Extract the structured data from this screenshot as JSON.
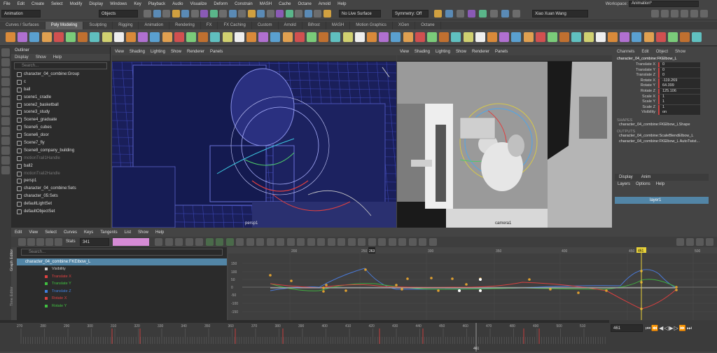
{
  "menubar": {
    "items": [
      "File",
      "Edit",
      "Create",
      "Select",
      "Modify",
      "Display",
      "Windows",
      "Key",
      "Playback",
      "Audio",
      "Visualize",
      "Deform",
      "Constrain",
      "MASH",
      "Cache",
      "Octane",
      "Arnold",
      "Help"
    ],
    "workspace_label": "Workspace:",
    "workspace_value": "Animation*"
  },
  "statusline": {
    "mode": "Animation",
    "select_mode": "Objects",
    "live_surface": "No Live Surface",
    "symmetry": "Symmetry: Off",
    "user": "Xiao Xuan Wang"
  },
  "shelf_tabs": [
    "Curves / Surfaces",
    "Poly Modeling",
    "Sculpting",
    "Rigging",
    "Animation",
    "Rendering",
    "FX",
    "FX Caching",
    "Custom",
    "Arnold",
    "Bifrost",
    "MASH",
    "Motion Graphics",
    "XGen",
    "Octane"
  ],
  "active_shelf": "Poly Modeling",
  "outliner": {
    "title": "Outliner",
    "menu": [
      "Display",
      "Show",
      "Help"
    ],
    "search_placeholder": "Search...",
    "items": [
      {
        "label": "character_04_combine:Group",
        "dim": false
      },
      {
        "label": "c",
        "dim": false
      },
      {
        "label": "ball",
        "dim": false
      },
      {
        "label": "scene1_cradle",
        "dim": false
      },
      {
        "label": "scene2_basketball",
        "dim": false
      },
      {
        "label": "scene3_study",
        "dim": false
      },
      {
        "label": "Scene4_graduate",
        "dim": false
      },
      {
        "label": "Scene5_cubes",
        "dim": false
      },
      {
        "label": "Scene6_door",
        "dim": false
      },
      {
        "label": "Scene7_fly",
        "dim": false
      },
      {
        "label": "Scene8_company_building",
        "dim": false
      },
      {
        "label": "motionTrail1Handle",
        "dim": true
      },
      {
        "label": "ball2",
        "dim": false
      },
      {
        "label": "motionTrail2Handle",
        "dim": true
      },
      {
        "label": "persp1",
        "dim": false
      },
      {
        "label": "character_04_combine:Sets",
        "dim": false
      },
      {
        "label": "character_05:Sets",
        "dim": false
      },
      {
        "label": "defaultLightSet",
        "dim": false
      },
      {
        "label": "defaultObjectSet",
        "dim": false
      }
    ]
  },
  "viewport_menu": [
    "View",
    "Shading",
    "Lighting",
    "Show",
    "Renderer",
    "Panels"
  ],
  "viewport1": {
    "camera": "persp1"
  },
  "viewport2": {
    "camera": "camera1"
  },
  "channelbox": {
    "menu": [
      "Channels",
      "Edit",
      "Object",
      "Show"
    ],
    "object": "character_04_combine:FKElbow_L",
    "channels": [
      {
        "name": "Translate X",
        "value": "0"
      },
      {
        "name": "Translate Y",
        "value": "0"
      },
      {
        "name": "Translate Z",
        "value": "0"
      },
      {
        "name": "Rotate X",
        "value": "-119.269"
      },
      {
        "name": "Rotate Y",
        "value": "64.399"
      },
      {
        "name": "Rotate Z",
        "value": "125.106"
      },
      {
        "name": "Scale X",
        "value": "1"
      },
      {
        "name": "Scale Y",
        "value": "1"
      },
      {
        "name": "Scale Z",
        "value": "1"
      },
      {
        "name": "Visibility",
        "value": "on"
      }
    ],
    "shapes_label": "SHAPES",
    "shape": "character_04_combine:FKElbow_LShape",
    "outputs_label": "OUTPUTS",
    "outputs": [
      "character_04_combine:ScaleBlendElbow_L",
      "character_04_combine:FKElbow_L AutoTwist..."
    ],
    "layer_tabs": [
      "Display",
      "Anim"
    ],
    "layer_menu": [
      "Layers",
      "Options",
      "Help"
    ],
    "layer_name": "layer1"
  },
  "graph": {
    "menu": [
      "Edit",
      "View",
      "Select",
      "Curves",
      "Keys",
      "Tangents",
      "List",
      "Show",
      "Help"
    ],
    "stats_label": "Stats",
    "stats_value": "341",
    "search_placeholder": "Search...",
    "side_label": "Graph Editor",
    "side_label2": "Time Editor",
    "object": "character_04_combine:FKElbow_L",
    "channels": [
      {
        "name": "Visibility",
        "color": "#cccccc"
      },
      {
        "name": "Translate X",
        "color": "#e04040"
      },
      {
        "name": "Translate Y",
        "color": "#40c040"
      },
      {
        "name": "Translate Z",
        "color": "#4080e0"
      },
      {
        "name": "Rotate X",
        "color": "#e04040"
      },
      {
        "name": "Rotate Y",
        "color": "#40c040"
      }
    ],
    "ruler": [
      "200",
      "250",
      "300",
      "350",
      "400",
      "450",
      "500"
    ],
    "current_frame": "461",
    "range_frame": "263",
    "yticks": [
      "150",
      "100",
      "50",
      "0",
      "-50",
      "-100",
      "-150"
    ]
  },
  "timeline": {
    "ticks": [
      "270",
      "280",
      "290",
      "300",
      "310",
      "320",
      "330",
      "340",
      "350",
      "360",
      "370",
      "380",
      "390",
      "400",
      "410",
      "420",
      "430",
      "440",
      "450",
      "460",
      "470",
      "480",
      "490",
      "500",
      "510"
    ],
    "current": "461",
    "frame_field": "461"
  }
}
